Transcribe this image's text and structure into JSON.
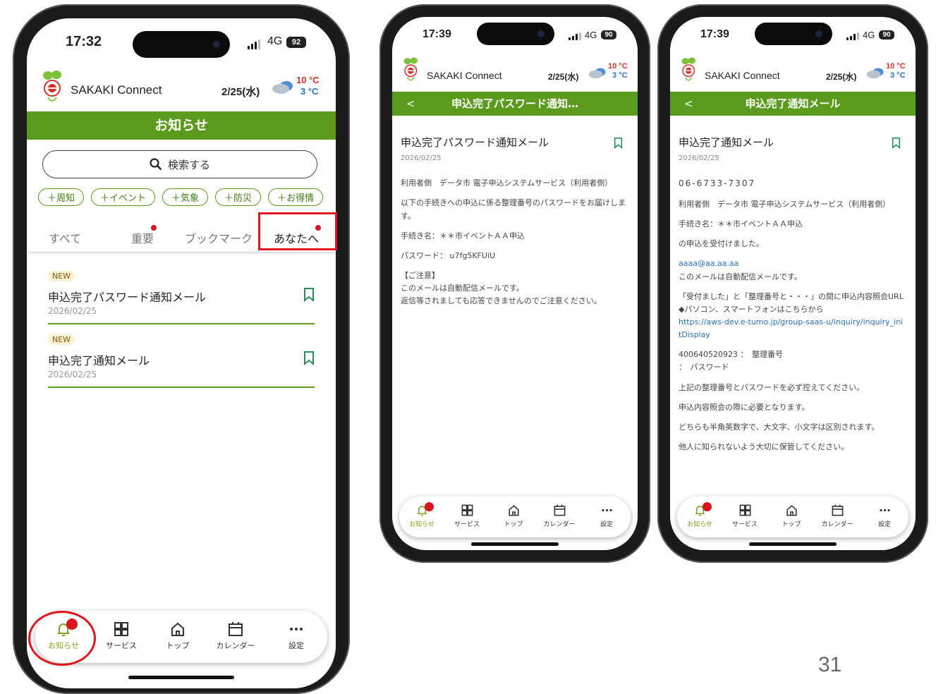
{
  "page_number": "31",
  "colors": {
    "accent_green": "#5a9a1c",
    "alert_red": "#e0141e",
    "temp_high": "#d9302e",
    "temp_low": "#2a72c6",
    "link": "#2a6fb8"
  },
  "phone1": {
    "status": {
      "time": "17:32",
      "network": "4G",
      "battery": "92"
    },
    "header": {
      "app_title": "SAKAKI Connect",
      "date": "2/25(水)",
      "temp_high": "10 °C",
      "temp_low": "3 °C"
    },
    "page_title": "お知らせ",
    "search": {
      "placeholder": "検索する",
      "icon": "search-icon"
    },
    "chips": [
      "＋周知",
      "＋イベント",
      "＋気象",
      "＋防災",
      "＋お得情"
    ],
    "tabs": [
      "すべて",
      "重要",
      "ブックマーク",
      "あなたへ"
    ],
    "items": [
      {
        "badge": "NEW",
        "title": "申込完了パスワード通知メール",
        "date": "2026/02/25"
      },
      {
        "badge": "NEW",
        "title": "申込完了通知メール",
        "date": "2026/02/25"
      }
    ]
  },
  "nav": [
    "お知らせ",
    "サービス",
    "トップ",
    "カレンダー",
    "設定"
  ],
  "phone2": {
    "status": {
      "time": "17:39",
      "network": "4G",
      "battery": "90"
    },
    "header": {
      "app_title": "SAKAKI Connect",
      "date": "2/25(水)",
      "temp_high": "10 °C",
      "temp_low": "3 °C"
    },
    "bar_title": "申込完了パスワード通知…",
    "title": "申込完了パスワード通知メール",
    "date": "2026/02/25",
    "lines": [
      "利用者側　データ市 電子申込システムサービス（利用者側）",
      "以下の手続きへの申込に係る整理番号のパスワードをお届けします。",
      "手続き名：＊＊市イベントＡＡ申込",
      "パスワード： u7fg5KFUiU",
      "【ご注意】",
      "このメールは自動配信メールです。",
      "返信等されましても応答できませんのでご注意ください。"
    ]
  },
  "phone3": {
    "status": {
      "time": "17:39",
      "network": "4G",
      "battery": "90"
    },
    "header": {
      "app_title": "SAKAKI Connect",
      "date": "2/25(水)",
      "temp_high": "10 °C",
      "temp_low": "3 °C"
    },
    "bar_title": "申込完了通知メール",
    "title": "申込完了通知メール",
    "date": "2026/02/25",
    "lines": [
      "06-6733-7307",
      "利用者側　データ市 電子申込システムサービス（利用者側）",
      "手続き名：＊＊市イベントＡＡ申込",
      "の申込を受付けました。",
      "aaaa@aa.aa.aa",
      "このメールは自動配信メールです。",
      "「受付ました」と「整理番号と・・・」の間に申込内容照会URL",
      "◆パソコン、スマートフォンはこちらから",
      "https://aws-dev.e-tumo.jp/group-saas-u/inquiry/inquiry_initDisplay",
      "400640520923 ：　整理番号",
      "：　パスワード",
      "上記の整理番号とパスワードを必ず控えてください。",
      "申込内容照会の際に必要となります。",
      "どちらも半角英数字で、大文字、小文字は区別されます。",
      "他人に知られないよう大切に保管してください。"
    ]
  }
}
